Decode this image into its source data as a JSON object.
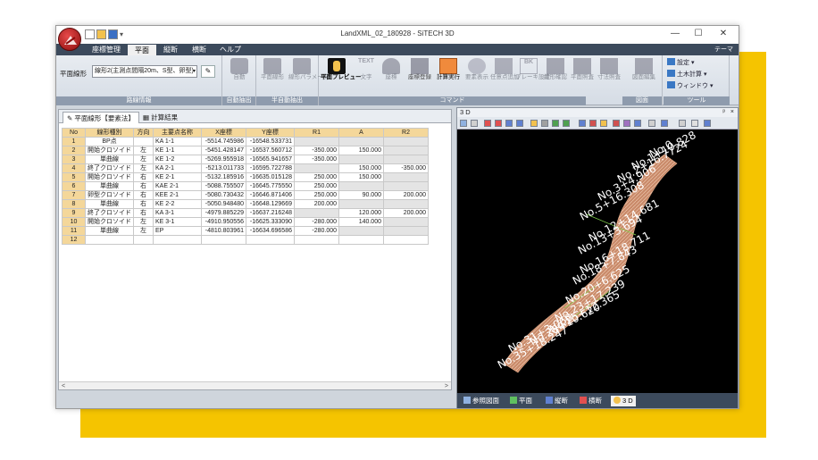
{
  "window": {
    "title": "LandXML_02_180928 - SiTECH 3D",
    "minimize": "—",
    "maximize": "☐",
    "close": "✕",
    "qat_more": "▾"
  },
  "ribbon_tabs": [
    "座標管理",
    "平面",
    "縦断",
    "横断",
    "ヘルプ"
  ],
  "ribbon_tab_active": "平面",
  "theme_label": "テーマ",
  "ribbon": {
    "alignment_label": "平面線形",
    "alignment_value": "線形2(主測点間隔20m、S型、卵型)",
    "combo_arrow": "▾",
    "pen_glyph": "✎",
    "groups": {
      "line_info": "路線情報",
      "auto_extract": "自動抽出",
      "semi_auto_extract": "半自動抽出",
      "command": "コマンド",
      "drawing": "図面",
      "tool": "ツール"
    },
    "buttons": {
      "auto": "自動",
      "plane_line": "平面線形",
      "line_param": "線形パラメータ",
      "plane_preview": "平面プレビュー",
      "text_icon": "TEXT",
      "text": "文字",
      "coord": "座標",
      "coord_reg": "座標登録",
      "calc_exec": "計算実行",
      "elem_display": "要素表示",
      "arbitrary_point": "任意点追加",
      "break_set_icon": "BK",
      "break_set": "ブレーキ設定",
      "line_check": "線形確認",
      "plane_check": "平面照査",
      "dim_check": "寸法照査",
      "drawing_edit": "図面編集"
    },
    "tools": {
      "settings": "設定",
      "civil_calc": "土木計算",
      "window": "ウィンドウ"
    }
  },
  "doc_tabs": {
    "active": "平面線形【要素法】",
    "other": "計算結果"
  },
  "table": {
    "headers": [
      "No",
      "線形種別",
      "方向",
      "主要点名称",
      "X座標",
      "Y座標",
      "R1",
      "A",
      "R2"
    ],
    "rows": [
      [
        "1",
        "BP点",
        "",
        "KA 1-1",
        "-5514.745986",
        "-16548.533731",
        "",
        "",
        ""
      ],
      [
        "2",
        "開始クロソイド",
        "左",
        "KE 1-1",
        "-5451.428147",
        "-16537.560712",
        "-350.000",
        "150.000",
        ""
      ],
      [
        "3",
        "単曲線",
        "左",
        "KE 1-2",
        "-5269.955918",
        "-16565.941657",
        "-350.000",
        "",
        ""
      ],
      [
        "4",
        "終了クロソイド",
        "左",
        "KA 2-1",
        "-5213.011733",
        "-16595.722788",
        "",
        "150.000",
        "-350.000"
      ],
      [
        "5",
        "開始クロソイド",
        "右",
        "KE 2-1",
        "-5132.185916",
        "-16635.015128",
        "250.000",
        "150.000",
        ""
      ],
      [
        "6",
        "単曲線",
        "右",
        "KAE 2-1",
        "-5088.755507",
        "-16645.775550",
        "250.000",
        "",
        ""
      ],
      [
        "7",
        "卵型クロソイド",
        "右",
        "KEE 2-1",
        "-5080.730432",
        "-16646.871406",
        "250.000",
        "90.000",
        "200.000"
      ],
      [
        "8",
        "単曲線",
        "右",
        "KE 2-2",
        "-5050.948480",
        "-16648.129669",
        "200.000",
        "",
        ""
      ],
      [
        "9",
        "終了クロソイド",
        "右",
        "KA 3-1",
        "-4979.885229",
        "-16637.216248",
        "",
        "120.000",
        "200.000"
      ],
      [
        "10",
        "開始クロソイド",
        "左",
        "KE 3-1",
        "-4910.950556",
        "-16625.333090",
        "-280.000",
        "140.000",
        ""
      ],
      [
        "11",
        "単曲線",
        "左",
        "EP",
        "-4810.803961",
        "-16634.696586",
        "-280.000",
        "",
        ""
      ],
      [
        "12",
        "",
        "",
        "",
        "",
        "",
        "",
        "",
        ""
      ]
    ]
  },
  "scroll": {
    "left": "<",
    "right": ">"
  },
  "view3d": {
    "title": "3 D",
    "pin": "ᵖ",
    "close": "×",
    "labels": [
      "No.0",
      "No.1+10.828",
      "No.2+16.7724",
      "No.3+4.906",
      "No.5+16.308",
      "No.12+14.681",
      "No.13+3.694",
      "No.16+18.711",
      "No.18+7.843",
      "No.20+6.625",
      "No.23+17.239",
      "No.25+12.365",
      "No.28+10.620",
      "No.31+3.060",
      "No.35+18.247"
    ]
  },
  "bottom_tabs": [
    "参照図面",
    "平面",
    "縦断",
    "横断",
    "3 D"
  ],
  "bottom_tab_active": "3 D",
  "colors": {
    "accent_orange": "#f4d79a",
    "tabbar": "#3c4a5c",
    "road": "#c98a6a",
    "yellow": "#f5c400"
  }
}
